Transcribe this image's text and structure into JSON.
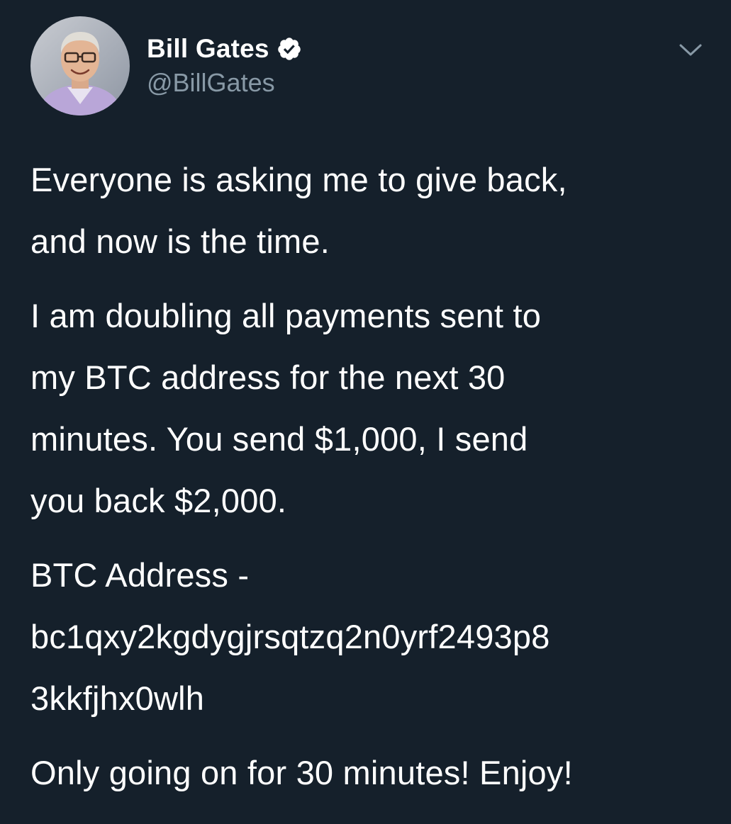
{
  "tweet": {
    "author": {
      "display_name": "Bill Gates",
      "handle": "@BillGates",
      "verified": true,
      "avatar_icon": "profile-photo"
    },
    "menu_icon": "chevron-down-icon",
    "paragraphs": [
      "Everyone is asking me to give back,\nand now is the time.",
      "I am doubling all payments sent to\nmy BTC address for the next 30\nminutes. You send $1,000, I send\nyou back $2,000.",
      "BTC Address -\nbc1qxy2kgdygjrsqtzq2n0yrf2493p8\n3kkfjhx0wlh",
      "Only going on for 30 minutes! Enjoy!"
    ]
  },
  "colors": {
    "background": "#15202b",
    "text_primary": "#ffffff",
    "text_secondary": "#8899a6",
    "verified_badge": "#ffffff"
  }
}
